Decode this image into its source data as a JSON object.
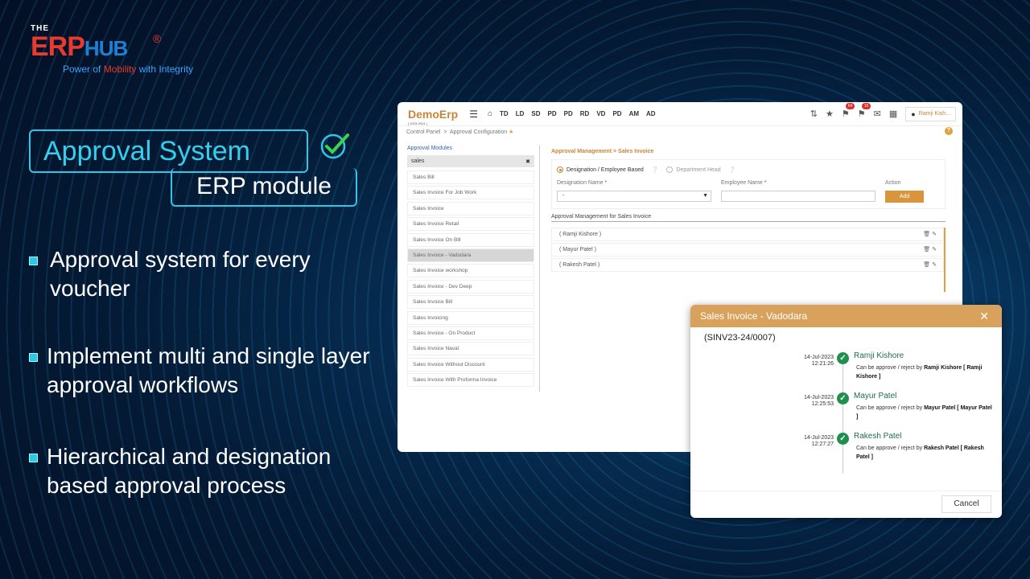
{
  "logo": {
    "the": "THE",
    "erp": "ERP",
    "hub": "HUB",
    "reg": "®",
    "tagline_a": "Power of ",
    "tagline_b": "Mobility",
    "tagline_c": " with Integrity"
  },
  "heading": {
    "title": "Approval System",
    "subtitle": "ERP module"
  },
  "bullets": [
    "Approval system for every voucher",
    "Implement multi and single layer approval workflows",
    "Hierarchical and designation based approval process"
  ],
  "erp": {
    "app_name": "DemoErp",
    "fy": "[ 2023-2024 ]",
    "nav": [
      "TD",
      "LD",
      "SD",
      "PD",
      "PD",
      "RD",
      "VD",
      "PD",
      "AM",
      "AD"
    ],
    "badges": {
      "notifications": "64",
      "alerts": "16"
    },
    "user": "Ramji Kish...",
    "breadcrumb": {
      "a": "Control Panel",
      "sep": ">",
      "b": "Approval Configuration"
    },
    "modules_title": "Approval Modules",
    "search_value": "sales",
    "modules": [
      "Sales Bill",
      "Sales Invoice For Job Work",
      "Sales Invoice",
      "Sales Invoice Retail",
      "Sales Invoice On Bill",
      "Sales Invoice - Vadodara",
      "Sales Invoice workshop",
      "Sales Invoice - Dev Deep",
      "Sales Invoice Bill",
      "Sales Invoicing",
      "Sales Invoice - On Product",
      "Sales Invoice Naval",
      "Sales Invoice Without Discount",
      "Sales Invoice With Proforma Invoice"
    ],
    "active_module_index": 5,
    "panel_breadcrumb": "Approval Management  > Sales Invoice",
    "radio_a": "Designation / Employee Based",
    "radio_b": "Department Head",
    "designation_label": "Designation Name",
    "employee_label": "Employee Name",
    "action_label": "Action",
    "designation_value": "-",
    "add_label": "Add",
    "list_title": "Approval Management for Sales Invoice",
    "approvers": [
      "( Ramji Kishore )",
      "( Mayur Patel )",
      "( Rakesh Patel )"
    ]
  },
  "dialog": {
    "title": "Sales Invoice - Vadodara",
    "number": "(SINV23-24/0007)",
    "entries": [
      {
        "date": "14-Jul-2023",
        "time": "12:21:26",
        "name": "Ramji Kishore",
        "desc": "Can be approve / reject by ",
        "by": "Ramji Kishore [ Ramji Kishore ]"
      },
      {
        "date": "14-Jul-2023",
        "time": "12:25:53",
        "name": "Mayur Patel",
        "desc": "Can be approve / reject by ",
        "by": "Mayur Patel [ Mayur Patel ]"
      },
      {
        "date": "14-Jul-2023",
        "time": "12:27:27",
        "name": "Rakesh Patel",
        "desc": "Can be approve / reject by ",
        "by": "Rakesh Patel [ Rakesh Patel ]"
      }
    ],
    "cancel_label": "Cancel"
  },
  "colors": {
    "accent": "#2ec7e8",
    "brand_red": "#e83a2f",
    "brand_orange": "#d9953d",
    "success": "#1f8f4e"
  }
}
